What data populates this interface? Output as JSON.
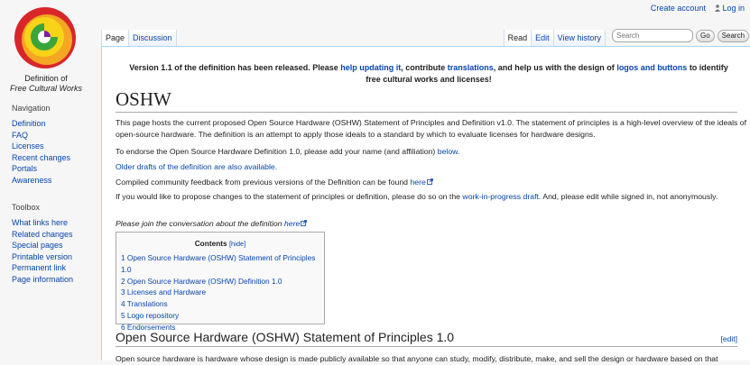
{
  "logo": {
    "line1": "Definition of",
    "line2": "Free Cultural Works"
  },
  "personal": {
    "create_account": "Create account",
    "login": "Log in"
  },
  "tabs_left": [
    "Page",
    "Discussion"
  ],
  "tabs_right": [
    "Read",
    "Edit",
    "View history"
  ],
  "search": {
    "placeholder": "Search",
    "go": "Go",
    "search_btn": "Search"
  },
  "nav": {
    "heading": "Navigation",
    "items": [
      "Definition",
      "FAQ",
      "Licenses",
      "Recent changes",
      "Portals",
      "Awareness"
    ]
  },
  "toolbox": {
    "heading": "Toolbox",
    "items": [
      "What links here",
      "Related changes",
      "Special pages",
      "Printable version",
      "Permanent link",
      "Page information"
    ]
  },
  "notice": {
    "t1": "Version 1.1 of the definition has been released. Please ",
    "l1": "help updating it",
    "t2": ", contribute ",
    "l2": "translations",
    "t3": ", and help us with the design of ",
    "l3": "logos and buttons",
    "t4": " to identify free cultural works and licenses!"
  },
  "page_title": "OSHW",
  "intro": "This page hosts the current proposed Open Source Hardware (OSHW) Statement of Principles and Definition v1.0. The statement of principles is a high-level overview of the ideals of open-source hardware. The definition is an attempt to apply those ideals to a standard by which to evaluate licenses for hardware designs.",
  "endorse": {
    "text": "To endorse the Open Source Hardware Definition 1.0, please add your name (and affiliation) ",
    "link": "below",
    "end": "."
  },
  "older_drafts": "Older drafts of the definition are also available.",
  "feedback": {
    "text": "Compiled community feedback from previous versions of the Definition can be found ",
    "link": "here"
  },
  "propose": {
    "t1": "If you would like to propose changes to the statement of principles or definition, please do so on the ",
    "link": "work-in-progress draft",
    "t2": ". And, please edit while signed in, not anonymously."
  },
  "join": {
    "text": "Please join the conversation about the definition ",
    "link": "here"
  },
  "toc": {
    "title": "Contents",
    "hide": "[hide]",
    "items": [
      "1 Open Source Hardware (OSHW) Statement of Principles 1.0",
      "2 Open Source Hardware (OSHW) Definition 1.0",
      "3 Licenses and Hardware",
      "4 Translations",
      "5 Logo repository",
      "6 Endorsements"
    ]
  },
  "section1": {
    "title": "Open Source Hardware (OSHW) Statement of Principles 1.0",
    "edit": "[edit]"
  },
  "section1_text": "Open source hardware is hardware whose design is made publicly available so that anyone can study, modify, distribute, make, and sell the design or hardware based on that",
  "colors": {
    "link": "#0645ad",
    "tab_border": "#a7d7f9",
    "logo_red": "#d8262b",
    "logo_orange": "#f5a623",
    "logo_yellow": "#f7d417",
    "logo_green": "#3aa53b"
  }
}
